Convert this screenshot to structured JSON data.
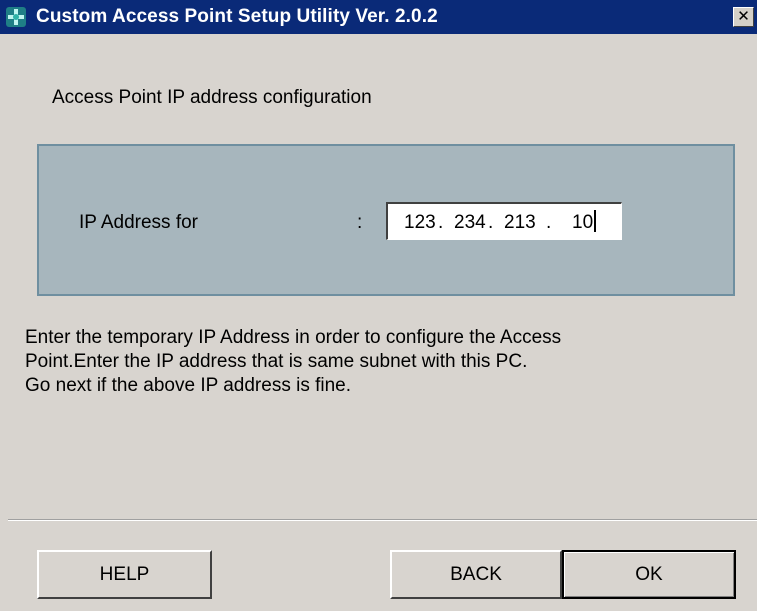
{
  "window": {
    "title": "Custom Access Point Setup Utility  Ver. 2.0.2",
    "close_label": "✕",
    "titlebar_color": "#0a2a78",
    "app_icon": "app-icon",
    "close_icon": "close-icon"
  },
  "main": {
    "heading": "Access Point IP address configuration",
    "ip_label": "IP Address for",
    "ip_colon": ":",
    "ip_octets": [
      "123",
      "234",
      "213",
      "10"
    ],
    "ip_dot": ".",
    "panel_color": "#a7b6bd",
    "instructions": [
      "Enter the temporary IP Address in order to configure the Access",
      "Point.Enter the IP address that is same subnet with this PC.",
      "Go next if the above IP address is fine."
    ]
  },
  "buttons": {
    "help": "HELP",
    "back": "BACK",
    "ok": "OK"
  }
}
